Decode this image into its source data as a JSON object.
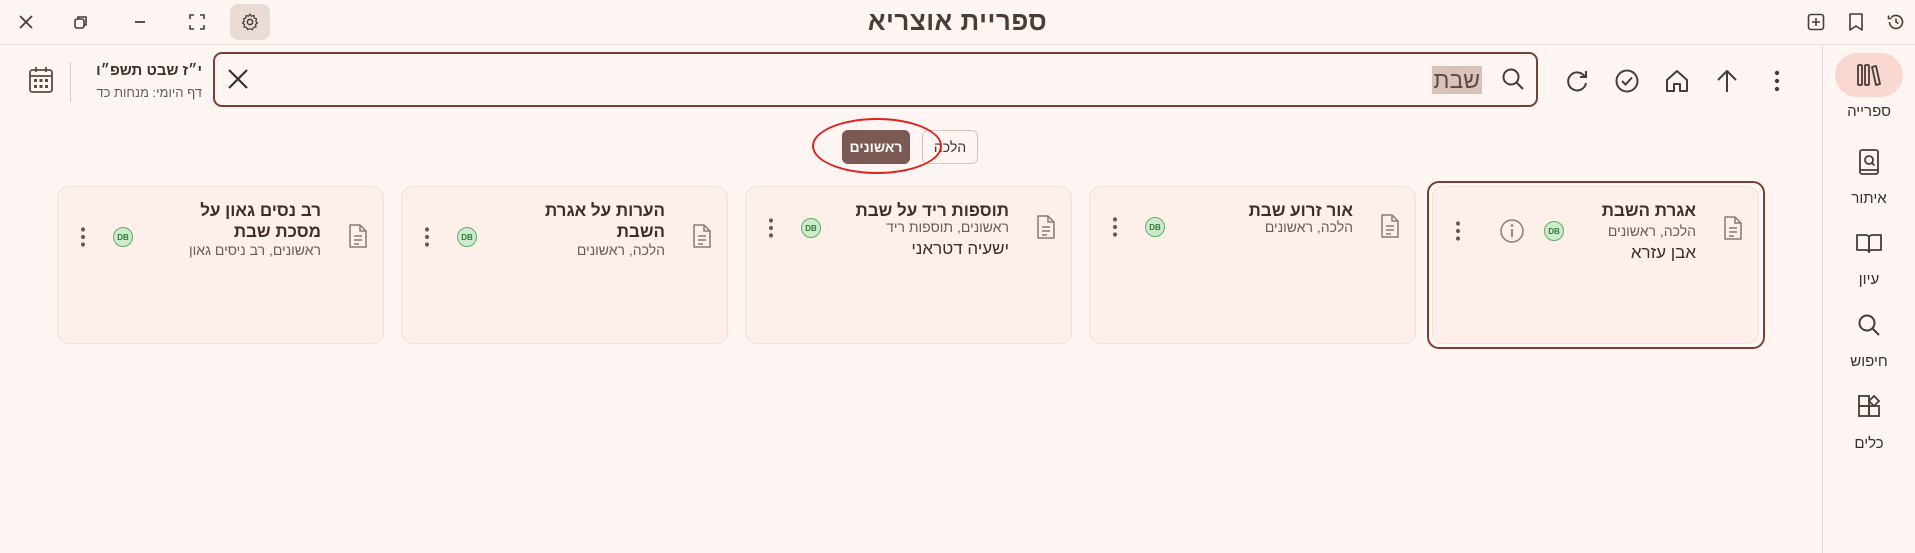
{
  "app": {
    "title": "ספריית אוצריא"
  },
  "window_controls": {
    "close": "close-icon",
    "restore": "restore-icon",
    "minimize": "minimize-icon",
    "fullscreen": "fullscreen-icon",
    "settings": "gear-icon",
    "new_tab": "add-box-icon",
    "bookmark": "bookmark-icon",
    "history": "history-icon"
  },
  "sidebar": {
    "items": [
      {
        "label": "ספרייה",
        "icon": "library-icon",
        "active": true
      },
      {
        "label": "איתור",
        "icon": "find-book-icon"
      },
      {
        "label": "עיון",
        "icon": "open-book-icon"
      },
      {
        "label": "חיפוש",
        "icon": "search-icon"
      },
      {
        "label": "כלים",
        "icon": "tools-icon"
      }
    ]
  },
  "toolbar": {
    "icons": [
      "more-vertical-icon",
      "arrow-up-icon",
      "home-icon",
      "check-circle-icon",
      "refresh-icon"
    ]
  },
  "search": {
    "value": "שבת"
  },
  "date": {
    "hebrew_date": "י״ז שבט תשפ״ו",
    "daf_yomi": "דף היומי: מנחות כד"
  },
  "filters": [
    {
      "label": "הלכה",
      "selected": false
    },
    {
      "label": "ראשונים",
      "selected": true
    }
  ],
  "results": [
    {
      "title": "אגרת השבת",
      "categories": "הלכה, ראשונים",
      "author": "אבן עזרא",
      "badge": "DB",
      "has_info": true,
      "focused": true
    },
    {
      "title": "אור זרוע שבת",
      "categories": "הלכה, ראשונים",
      "author": "",
      "badge": "DB"
    },
    {
      "title": "תוספות ריד על שבת",
      "categories": "ראשונים, תוספות ריד",
      "author": "ישעיה דטראני",
      "badge": "DB"
    },
    {
      "title": "הערות על אגרת השבת",
      "categories": "הלכה, ראשונים",
      "author": "",
      "badge": "DB"
    },
    {
      "title": "רב נסים גאון על מסכת שבת",
      "categories": "ראשונים, רב ניסים גאון",
      "author": "",
      "badge": "DB"
    }
  ],
  "colors": {
    "background": "#fff6f3",
    "card": "#ffefeb",
    "accent": "#7a3f37",
    "chip_selected": "#7a5a52",
    "badge_green": "#57b45e",
    "annotation": "#e0211e"
  }
}
